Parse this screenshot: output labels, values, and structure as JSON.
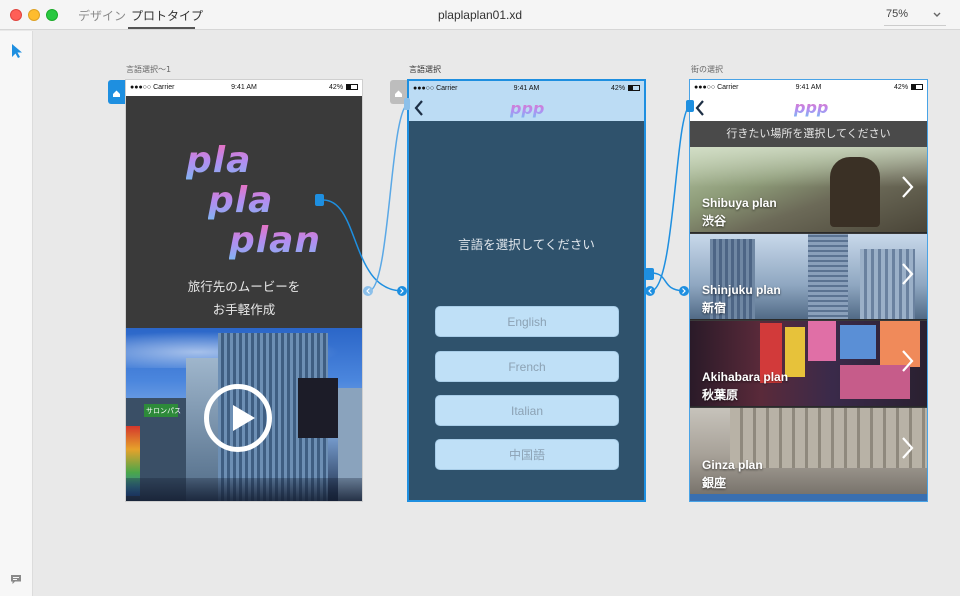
{
  "window": {
    "title": "plaplaplan01.xd",
    "tabs": [
      "デザイン",
      "プロトタイプ"
    ],
    "active_tab": "プロトタイプ",
    "zoom": "75%"
  },
  "icons": {
    "select_tool": "pointer-arrow-icon",
    "comment": "comment-icon",
    "home": "home-icon",
    "link": "link-arrow-icon"
  },
  "colors": {
    "accent": "#1e8fe0",
    "artboard2_bg": "#2f526c",
    "button_bg": "#bfe0f7"
  },
  "artboards": [
    {
      "label": "言語選択～1",
      "status": {
        "carrier": "●●●○○ Carrier",
        "time": "9:41 AM",
        "battery": "42%"
      },
      "logo_lines": [
        "pla",
        "pla",
        "plan"
      ],
      "tagline": [
        "旅行先のムービーを",
        "お手軽作成"
      ],
      "hero_sign": "サロンパス"
    },
    {
      "label": "言語選択",
      "status": {
        "carrier": "●●●○○ Carrier",
        "time": "9:41 AM",
        "battery": "42%"
      },
      "logo": "ppp",
      "prompt": "言語を選択してください",
      "buttons": [
        "English",
        "French",
        "Italian",
        "中国語"
      ]
    },
    {
      "label": "街の選択",
      "status": {
        "carrier": "●●●○○ Carrier",
        "time": "9:41 AM",
        "battery": "42%"
      },
      "logo": "ppp",
      "prompt": "行きたい場所を選択してください",
      "cities": [
        {
          "en": "Shibuya plan",
          "jp": "渋谷"
        },
        {
          "en": "Shinjuku plan",
          "jp": "新宿"
        },
        {
          "en": "Akihabara plan",
          "jp": "秋葉原"
        },
        {
          "en": "Ginza plan",
          "jp": "銀座"
        }
      ]
    }
  ]
}
